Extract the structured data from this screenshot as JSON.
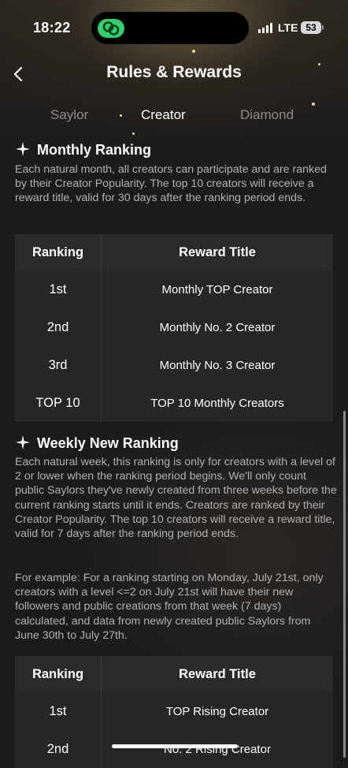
{
  "status_bar": {
    "time": "18:22",
    "network": "LTE",
    "battery": "53"
  },
  "header": {
    "title": "Rules & Rewards"
  },
  "tabs": [
    {
      "label": "Saylor",
      "active": false
    },
    {
      "label": "Creator",
      "active": true
    },
    {
      "label": "Diamond",
      "active": false
    }
  ],
  "sections": [
    {
      "title": "Monthly Ranking",
      "paragraphs": [
        "Each natural month, all creators can participate and are ranked by their Creator Popularity. The top 10 creators will receive a reward title, valid for 30 days after the ranking period ends."
      ],
      "table": {
        "headers": [
          "Ranking",
          "Reward Title"
        ],
        "rows": [
          [
            "1st",
            "Monthly TOP Creator"
          ],
          [
            "2nd",
            "Monthly No. 2 Creator"
          ],
          [
            "3rd",
            "Monthly No. 3 Creator"
          ],
          [
            "TOP 10",
            "TOP 10 Monthly Creators"
          ]
        ]
      }
    },
    {
      "title": "Weekly New Ranking",
      "paragraphs": [
        "Each natural week, this ranking is only for creators with a level of 2 or lower when the ranking period begins. We'll only count public Saylors they've newly created from three weeks before the current ranking starts until it ends. Creators are ranked by their Creator Popularity. The top 10 creators will receive a reward title, valid for 7 days after the ranking period ends.",
        "For example: For a ranking starting on Monday, July 21st, only creators with a level <=2 on July 21st will have their new followers and public creations from that week (7 days) calculated, and data from newly created public Saylors from June 30th to July 27th."
      ],
      "table": {
        "headers": [
          "Ranking",
          "Reward Title"
        ],
        "rows": [
          [
            "1st",
            "TOP Rising Creator"
          ],
          [
            "2nd",
            "No. 2 Rising Creator"
          ]
        ]
      }
    }
  ],
  "colors": {
    "accent_sparkle": "#e8d58a",
    "inactive_tab": "#8d8a86",
    "body_text": "#b3b1ae",
    "table_bg": "#262628"
  }
}
